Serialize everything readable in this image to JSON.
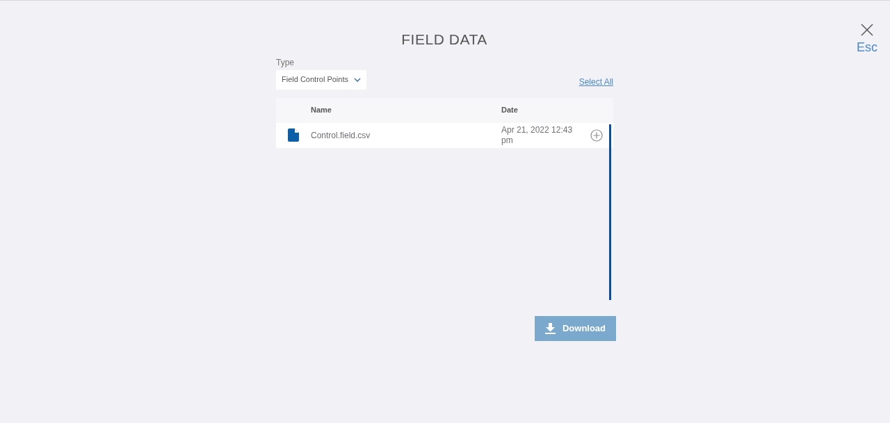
{
  "close": {
    "icon_label": "Esc"
  },
  "title": "FIELD DATA",
  "type_field": {
    "label": "Type",
    "value": "Field Control Points"
  },
  "select_all": "Select All",
  "table": {
    "columns": [
      "Name",
      "Date"
    ],
    "rows": [
      {
        "name": "Control.field.csv",
        "date": "Apr 21, 2022 12:43 pm",
        "selected": false
      }
    ]
  },
  "download_button": {
    "label": "Download",
    "disabled": true
  }
}
